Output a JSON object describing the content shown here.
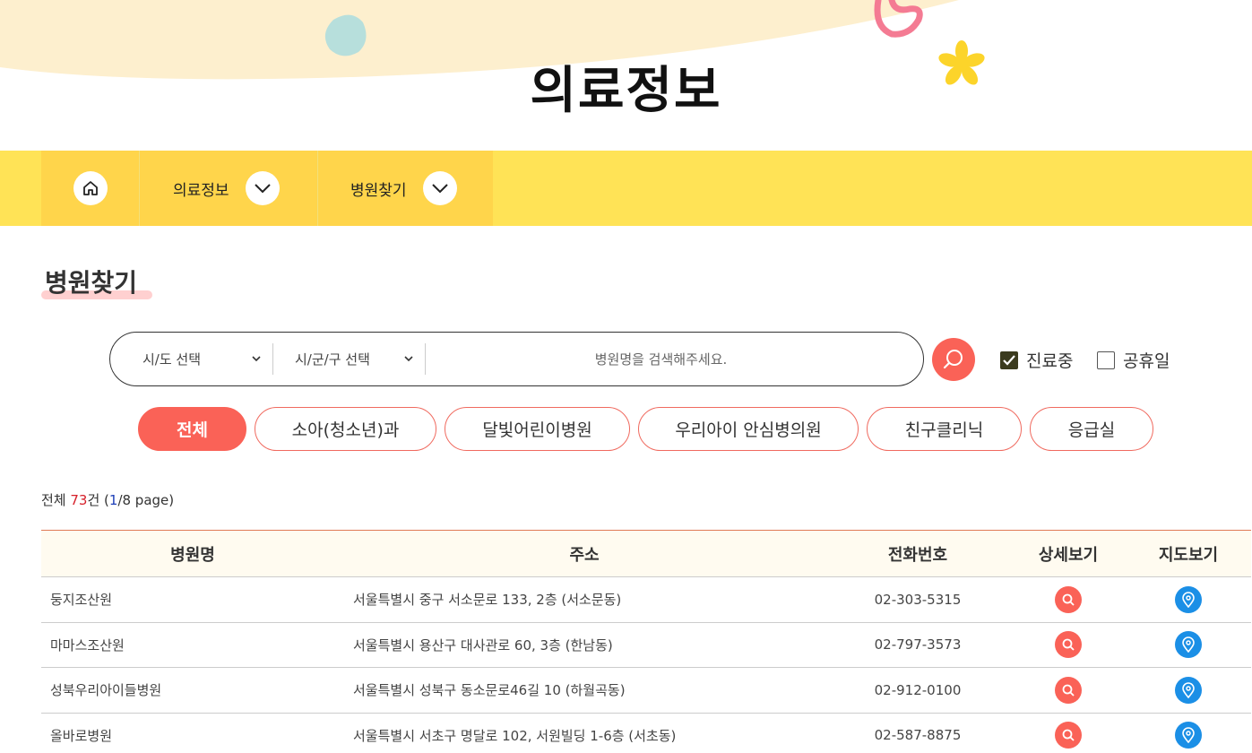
{
  "header": {
    "title": "의료정보"
  },
  "nav": {
    "home_icon": "home-icon",
    "items": [
      {
        "label": "의료정보"
      },
      {
        "label": "병원찾기"
      }
    ]
  },
  "section": {
    "title": "병원찾기"
  },
  "search": {
    "sido_label": "시/도 선택",
    "sigungu_label": "시/군/구 선택",
    "placeholder": "병원명을 검색해주세요."
  },
  "filters": [
    {
      "label": "진료중",
      "checked": true
    },
    {
      "label": "공휴일",
      "checked": false
    }
  ],
  "tabs": [
    {
      "label": "전체",
      "active": true
    },
    {
      "label": "소아(청소년)과"
    },
    {
      "label": "달빛어린이병원"
    },
    {
      "label": "우리아이 안심병의원"
    },
    {
      "label": "친구클리닉"
    },
    {
      "label": "응급실"
    }
  ],
  "count": {
    "prefix": "전체 ",
    "total": "73",
    "suffix": "건 (",
    "page": "1",
    "page_total": "/8 page)"
  },
  "table": {
    "headers": [
      "병원명",
      "주소",
      "전화번호",
      "상세보기",
      "지도보기"
    ],
    "rows": [
      {
        "name": "둥지조산원",
        "address": "서울특별시 중구 서소문로 133, 2층 (서소문동)",
        "phone": "02-303-5315"
      },
      {
        "name": "마마스조산원",
        "address": "서울특별시 용산구 대사관로 60, 3층 (한남동)",
        "phone": "02-797-3573"
      },
      {
        "name": "성북우리아이들병원",
        "address": "서울특별시 성북구 동소문로46길 10 (하월곡동)",
        "phone": "02-912-0100"
      },
      {
        "name": "올바로병원",
        "address": "서울특별시 서초구 명달로 102, 서원빌딩 1-6층 (서초동)",
        "phone": "02-587-8875"
      }
    ]
  },
  "colors": {
    "accent": "#fa6257",
    "nav_bg": "#ffe356",
    "map_icon": "#1b8fe6"
  }
}
